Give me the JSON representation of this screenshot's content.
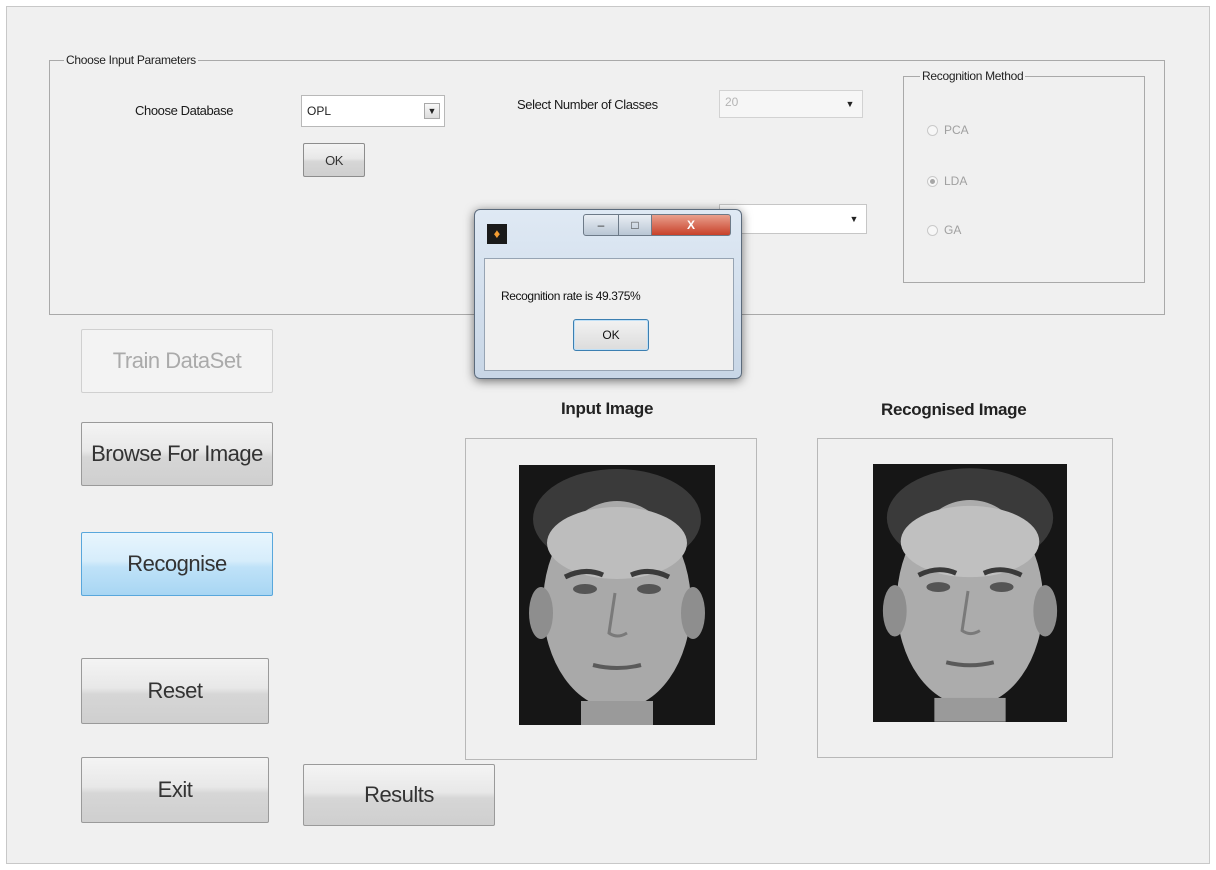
{
  "params": {
    "legend": "Choose Input Parameters",
    "database_label": "Choose Database",
    "database_value": "OPL",
    "ok_label": "OK",
    "classes_label": "Select Number of Classes",
    "classes_value": "20",
    "second_select_value": ""
  },
  "method": {
    "legend": "Recognition Method",
    "options": [
      {
        "label": "PCA",
        "selected": false
      },
      {
        "label": "LDA",
        "selected": true
      },
      {
        "label": "GA",
        "selected": false
      }
    ]
  },
  "buttons": {
    "train": "Train DataSet",
    "browse": "Browse For Image",
    "recognise": "Recognise",
    "reset": "Reset",
    "exit": "Exit",
    "results": "Results"
  },
  "panels": {
    "input_title": "Input Image",
    "recognised_title": "Recognised Image"
  },
  "dialog": {
    "message": "Recognition rate is 49.375%",
    "ok_label": "OK",
    "close_glyph": "X",
    "min_glyph": "–",
    "max_glyph": "□",
    "app_icon_glyph": "♦"
  }
}
